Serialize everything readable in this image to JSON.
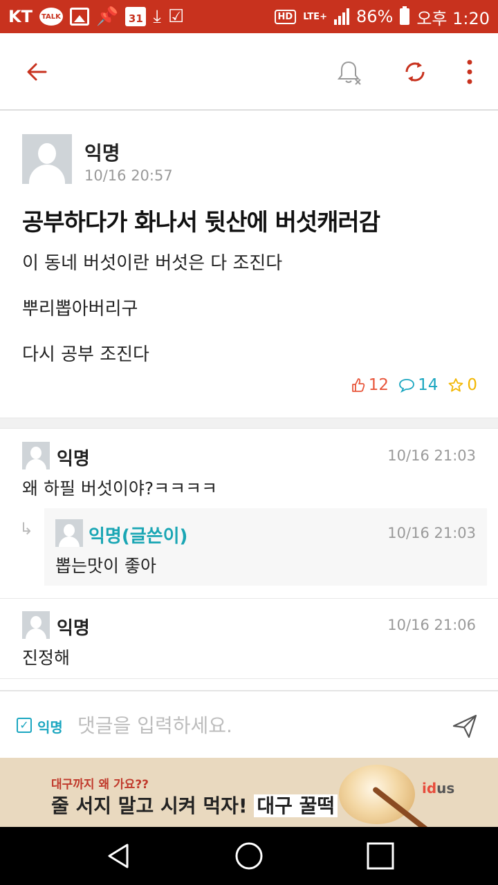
{
  "status_bar": {
    "carrier": "KT",
    "talk_label": "TALK",
    "calendar_day": "31",
    "hd": "HD",
    "network": "LTE+",
    "battery": "86%",
    "time": "오후 1:20"
  },
  "post": {
    "author": "익명",
    "time": "10/16 20:57",
    "title": "공부하다가 화나서 뒷산에 버섯캐러감",
    "lines": [
      "이 동네 버섯이란 버섯은 다 조진다",
      "뿌리뽑아버리구",
      "다시 공부 조진다"
    ],
    "likes": "12",
    "comments": "14",
    "scraps": "0"
  },
  "comments": [
    {
      "author": "익명",
      "time": "10/16 21:03",
      "text": "왜 하필 버섯이야?ㅋㅋㅋㅋ",
      "reply": {
        "author": "익명(글쓴이)",
        "time": "10/16 21:03",
        "text": "뽑는맛이 좋아"
      }
    },
    {
      "author": "익명",
      "time": "10/16 21:06",
      "text": "진정해"
    }
  ],
  "input_bar": {
    "anon_label": "익명",
    "placeholder": "댓글을 입력하세요."
  },
  "ad": {
    "sub": "대구까지 왜 가요??",
    "main": "줄 서지 말고 시켜 먹자!",
    "highlight": "대구 꿀떡",
    "logo_a": "id",
    "logo_b": "us"
  },
  "colors": {
    "accent": "#c8321e",
    "like": "#e8553a",
    "comment": "#1aa6c0",
    "scrap": "#f2b600"
  },
  "icons": [
    "back-arrow-icon",
    "bell-off-icon",
    "refresh-icon",
    "more-vert-icon",
    "send-icon",
    "nav-back-icon",
    "nav-home-icon",
    "nav-recent-icon"
  ]
}
